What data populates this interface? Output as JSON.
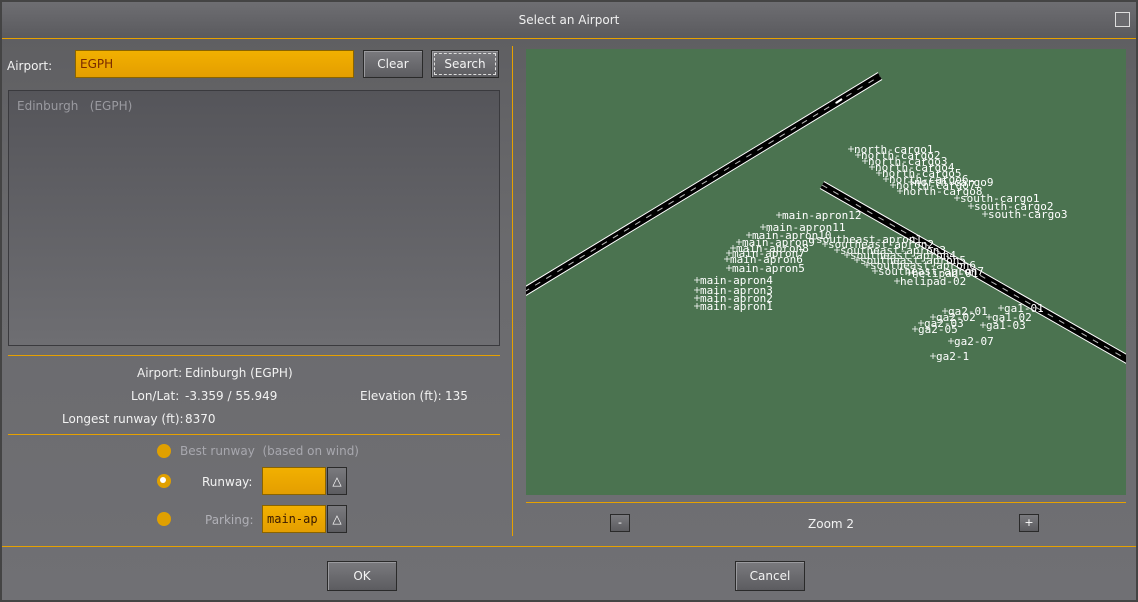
{
  "window": {
    "title": "Select an Airport"
  },
  "search": {
    "airport_label": "Airport:",
    "airport_value": "EGPH",
    "clear_label": "Clear",
    "search_label": "Search"
  },
  "results": [
    {
      "name": "Edinburgh",
      "code": "(EGPH)"
    }
  ],
  "info": {
    "airport_label": "Airport:",
    "airport_value": "Edinburgh (EGPH)",
    "lonlat_label": "Lon/Lat:",
    "lonlat_value": "-3.359 / 55.949",
    "elevation_label": "Elevation (ft):",
    "elevation_value": "135",
    "runway_label": "Longest runway (ft):",
    "runway_value": "8370"
  },
  "options": {
    "best_runway_label": "Best runway",
    "best_runway_note": "(based on wind)",
    "runway_label": "Runway:",
    "runway_value": "",
    "parking_label": "Parking:",
    "parking_value": "main-ap",
    "selected": "runway"
  },
  "map": {
    "zoom_label": "Zoom 2",
    "zoom_out": "-",
    "zoom_in": "+",
    "parking_labels": [
      "north-cargo1",
      "north-cargo2",
      "north-cargo3",
      "north-cargo4",
      "north-cargo5",
      "north-cargo6",
      "north-cargo7",
      "north-cargo8",
      "north-cargo9",
      "south-cargo1",
      "south-cargo2",
      "south-cargo3",
      "main-apron12",
      "main-apron11",
      "main-apron10",
      "main-apron9",
      "main-apron8",
      "main-apron7",
      "main-apron6",
      "main-apron5",
      "main-apron4",
      "main-apron3",
      "main-apron2",
      "main-apron1",
      "southeast-apron1",
      "southeast-apron2",
      "southeast-apron3",
      "southeast-apron4",
      "southeast-apron5",
      "southeast-apron6",
      "southeast-apron7",
      "helipad-01",
      "helipad-02",
      "ga2-01",
      "ga2-02",
      "ga2-03",
      "ga2-05",
      "ga2-07",
      "ga2-1",
      "ga1-01",
      "ga1-02",
      "ga1-03"
    ],
    "colors": {
      "grass": "#4b7350",
      "runway": "#000000",
      "label": "#ffffff"
    }
  },
  "footer": {
    "ok_label": "OK",
    "cancel_label": "Cancel"
  },
  "colors": {
    "accent": "#e6a100",
    "panel": "#6a6a6d"
  }
}
